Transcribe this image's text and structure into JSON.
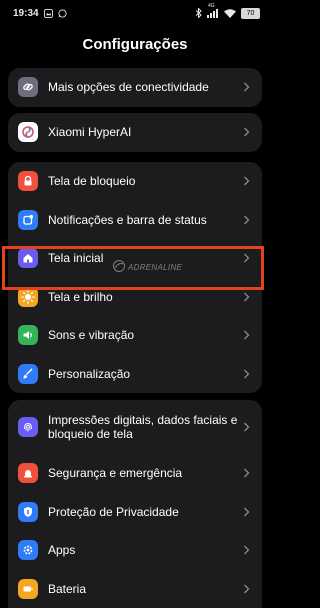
{
  "status_bar": {
    "time": "19:34",
    "network_badge": "4G",
    "battery": "70"
  },
  "header": {
    "title": "Configurações"
  },
  "groups": [
    {
      "items": [
        {
          "label": "Mais opções de conectividade",
          "icon": "link-icon",
          "color": "#6e6e80"
        }
      ]
    },
    {
      "items": [
        {
          "label": "Xiaomi HyperAI",
          "icon": "hyperai-swirl-icon",
          "color": "#ffffff"
        }
      ]
    },
    {
      "items": [
        {
          "label": "Tela de bloqueio",
          "icon": "lock-icon",
          "color": "#f0513e"
        },
        {
          "label": "Notificações e barra de status",
          "icon": "notification-icon",
          "color": "#2f7cf6"
        },
        {
          "label": "Tela inicial",
          "icon": "home-icon",
          "color": "#6a5cf0"
        },
        {
          "label": "Tela e brilho",
          "icon": "sun-icon",
          "color": "#f5a623"
        },
        {
          "label": "Sons e vibração",
          "icon": "volume-icon",
          "color": "#34b35a"
        },
        {
          "label": "Personalização",
          "icon": "brush-icon",
          "color": "#2f7cf6"
        }
      ]
    },
    {
      "items": [
        {
          "label": "Impressões digitais, dados faciais e bloqueio de tela",
          "icon": "fingerprint-icon",
          "color": "#6a5cf0"
        },
        {
          "label": "Segurança e emergência",
          "icon": "emergency-icon",
          "color": "#f0513e"
        },
        {
          "label": "Proteção de Privacidade",
          "icon": "privacy-shield-icon",
          "color": "#2f7cf6"
        },
        {
          "label": "Apps",
          "icon": "apps-gear-icon",
          "color": "#2f7cf6"
        },
        {
          "label": "Bateria",
          "icon": "battery-icon",
          "color": "#f5a623"
        }
      ]
    }
  ],
  "watermark": {
    "text": "ADRENALINE"
  },
  "colors": {
    "highlight": "#e4411e",
    "card": "#1c1c1e",
    "background": "#000000"
  }
}
